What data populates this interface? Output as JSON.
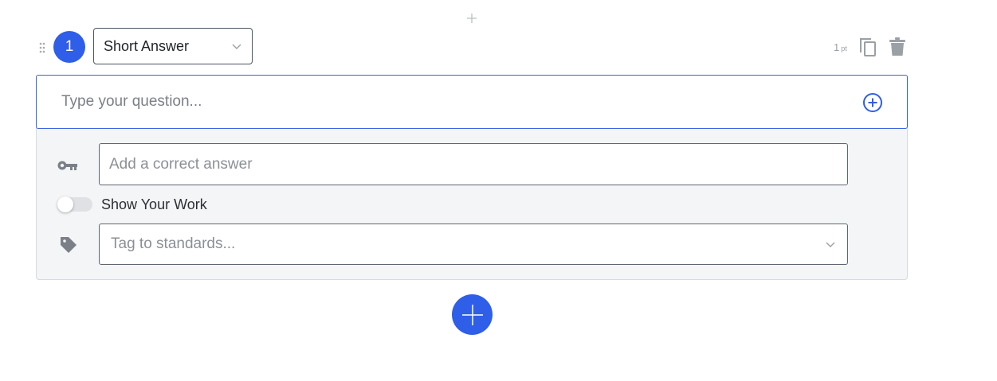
{
  "question": {
    "number": "1",
    "type_label": "Short Answer",
    "points": "1",
    "points_unit": "pt",
    "question_placeholder": "Type your question...",
    "answer_placeholder": "Add a correct answer",
    "show_work_label": "Show Your Work",
    "show_work_enabled": false,
    "tag_placeholder": "Tag to standards..."
  },
  "icons": {
    "top": "plus-icon",
    "drag": "drag-handle-icon",
    "copy": "copy-icon",
    "delete": "trash-icon",
    "add": "add-circle-icon",
    "key": "key-icon",
    "tag": "tag-icon",
    "fab": "plus-icon"
  },
  "colors": {
    "accent": "#2f5ee8",
    "panel": "#f4f5f7"
  }
}
